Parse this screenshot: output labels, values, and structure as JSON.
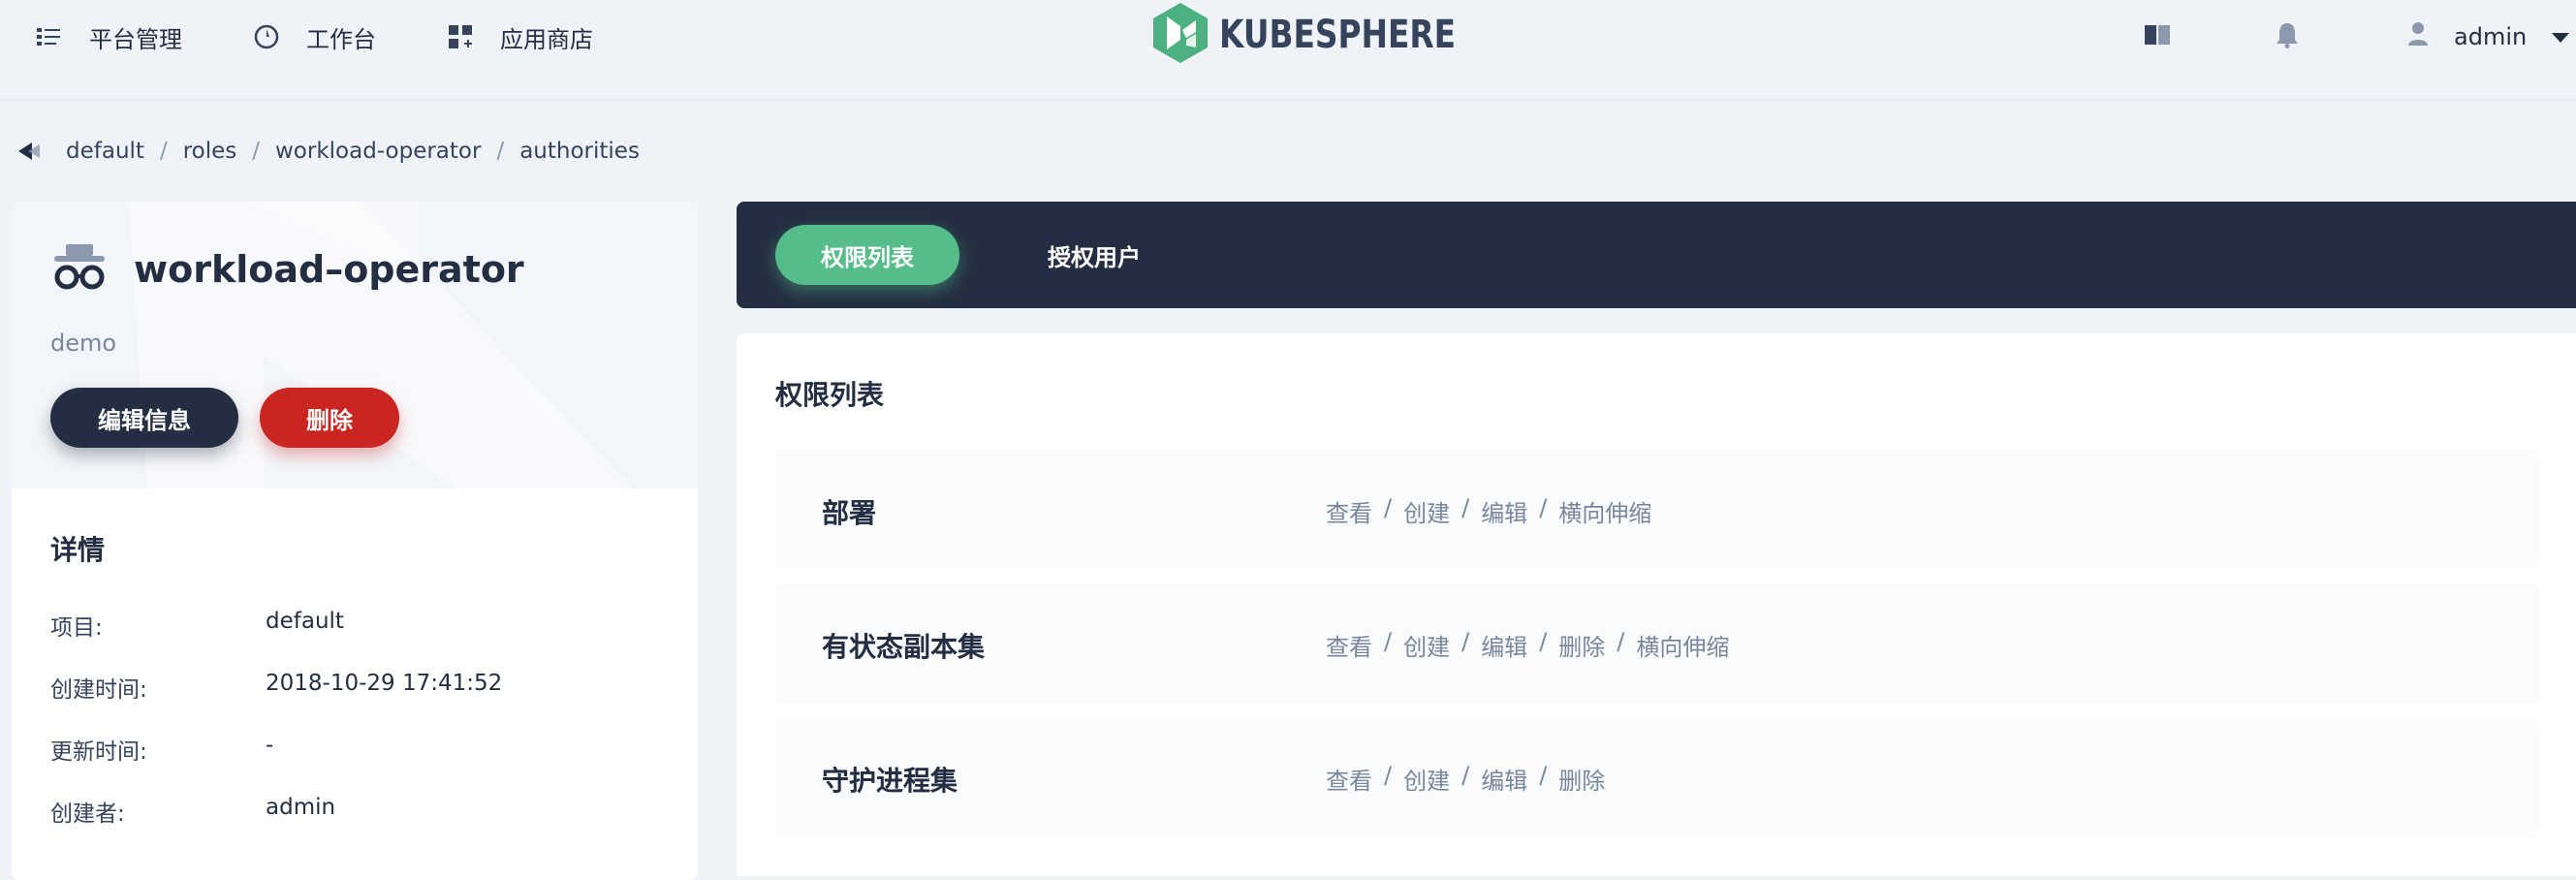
{
  "nav": {
    "platform": "平台管理",
    "workbench": "工作台",
    "appstore": "应用商店",
    "logo": "KUBESPHERE",
    "user": "admin"
  },
  "breadcrumb": [
    "default",
    "roles",
    "workload-operator",
    "authorities"
  ],
  "role": {
    "name": "workload–operator",
    "description": "demo",
    "edit_label": "编辑信息",
    "delete_label": "删除"
  },
  "details": {
    "title": "详情",
    "rows": [
      {
        "key": "项目:",
        "value": "default"
      },
      {
        "key": "创建时间:",
        "value": "2018-10-29 17:41:52"
      },
      {
        "key": "更新时间:",
        "value": "-"
      },
      {
        "key": "创建者:",
        "value": "admin"
      }
    ]
  },
  "tabs": {
    "authorities": "权限列表",
    "users": "授权用户"
  },
  "panel": {
    "title": "权限列表",
    "rows": [
      {
        "name": "部署",
        "perms": [
          "查看",
          "创建",
          "编辑",
          "横向伸缩"
        ]
      },
      {
        "name": "有状态副本集",
        "perms": [
          "查看",
          "创建",
          "编辑",
          "删除",
          "横向伸缩"
        ]
      },
      {
        "name": "守护进程集",
        "perms": [
          "查看",
          "创建",
          "编辑",
          "删除"
        ]
      }
    ]
  },
  "colors": {
    "dark": "#242e42",
    "green": "#55bc8a",
    "red": "#ca2621",
    "bg": "#eff2f7",
    "muted": "#79879c"
  },
  "icons": [
    "list-icon",
    "dashboard-icon",
    "apps-icon",
    "kubesphere-logo-icon",
    "book-icon",
    "bell-icon",
    "user-icon",
    "chevron-down-icon",
    "back-icon",
    "spy-icon"
  ]
}
